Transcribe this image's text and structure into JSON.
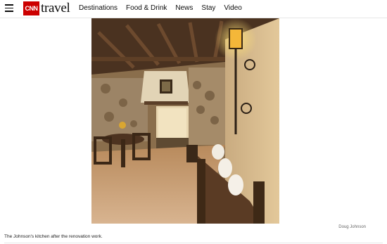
{
  "header": {
    "brand": "CNN",
    "section": "travel",
    "nav": [
      "Destinations",
      "Food & Drink",
      "News",
      "Stay",
      "Video"
    ]
  },
  "photo": {
    "credit": "Doug Johnson",
    "caption": "The Johnson's kitchen after the renovation work."
  },
  "colors": {
    "brand_red": "#cc0000"
  },
  "icons": {
    "menu": "hamburger-menu-icon"
  }
}
